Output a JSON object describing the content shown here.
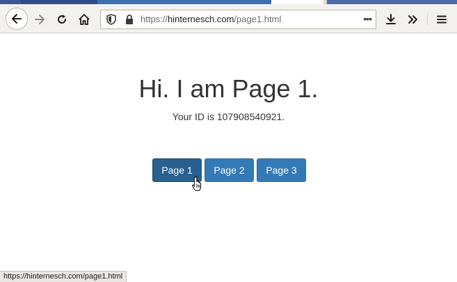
{
  "browser": {
    "url_prefix": "https://",
    "url_host": "hinternesch.com",
    "url_path": "/page1.html",
    "page_actions_label": "•••",
    "icons": {
      "back": "back-arrow-icon",
      "forward": "forward-arrow-icon",
      "reload": "reload-icon",
      "home": "home-icon",
      "tracking": "shield-icon",
      "security": "lock-icon",
      "download": "download-icon",
      "overflow": "double-chevron-icon",
      "menu": "hamburger-menu-icon"
    }
  },
  "page": {
    "heading": "Hi. I am Page 1.",
    "id_text": "Your ID is 107908540921.",
    "buttons": [
      {
        "label": "Page 1",
        "active": true
      },
      {
        "label": "Page 2",
        "active": false
      },
      {
        "label": "Page 3",
        "active": false
      }
    ]
  },
  "status_bar": {
    "text": "https://hinternesch.com/page1.html"
  },
  "colors": {
    "button_primary": "#337ab7",
    "button_active": "#286090",
    "heading_text": "#333333"
  }
}
